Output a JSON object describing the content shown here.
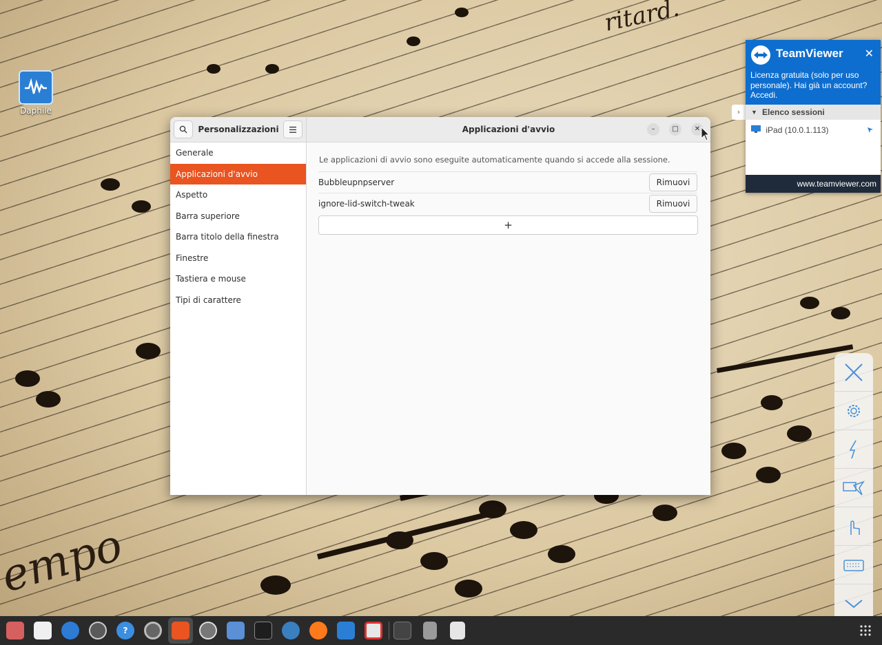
{
  "desktop": {
    "icon_label": "Daphile"
  },
  "window": {
    "left_title": "Personalizzazioni",
    "main_title": "Applicazioni d'avvio",
    "sidebar": {
      "items": [
        {
          "label": "Generale"
        },
        {
          "label": "Applicazioni d'avvio",
          "active": true
        },
        {
          "label": "Aspetto"
        },
        {
          "label": "Barra superiore"
        },
        {
          "label": "Barra titolo della finestra"
        },
        {
          "label": "Finestre"
        },
        {
          "label": "Tastiera e mouse"
        },
        {
          "label": "Tipi di carattere"
        }
      ]
    },
    "content": {
      "description": "Le applicazioni di avvio sono eseguite automaticamente quando si accede alla sessione.",
      "apps": [
        {
          "name": "Bubbleupnpserver",
          "remove_label": "Rimuovi"
        },
        {
          "name": "ignore-lid-switch-tweak",
          "remove_label": "Rimuovi"
        }
      ],
      "add_label": "+"
    }
  },
  "teamviewer": {
    "brand": "TeamViewer",
    "message": "Licenza gratuita (solo per uso personale). Hai già un account? Accedi.",
    "section_title": "Elenco sessioni",
    "session": "iPad (10.0.1.113)",
    "footer": "www.teamviewer.com"
  },
  "side_toolbar": {
    "icons": [
      "close-icon",
      "gear-icon",
      "lightning-icon",
      "remote-pointer-icon",
      "touch-icon",
      "keyboard-icon",
      "chevron-down-icon"
    ]
  },
  "taskbar": {
    "icons": [
      "files-icon",
      "photos-icon",
      "app-store-icon",
      "software-updater-icon",
      "help-icon",
      "settings-icon",
      "tweaks-icon",
      "chat-icon",
      "display-icon",
      "system-monitor-icon",
      "media-icon",
      "firefox-icon",
      "daphile-icon",
      "software-icon",
      "screenshot-icon",
      "usb-icon",
      "trash-icon",
      "app-grid-icon"
    ]
  },
  "colors": {
    "accent": "#e95420",
    "teamviewer_blue": "#0e6ecf",
    "taskbar": "#2a2a2a"
  }
}
